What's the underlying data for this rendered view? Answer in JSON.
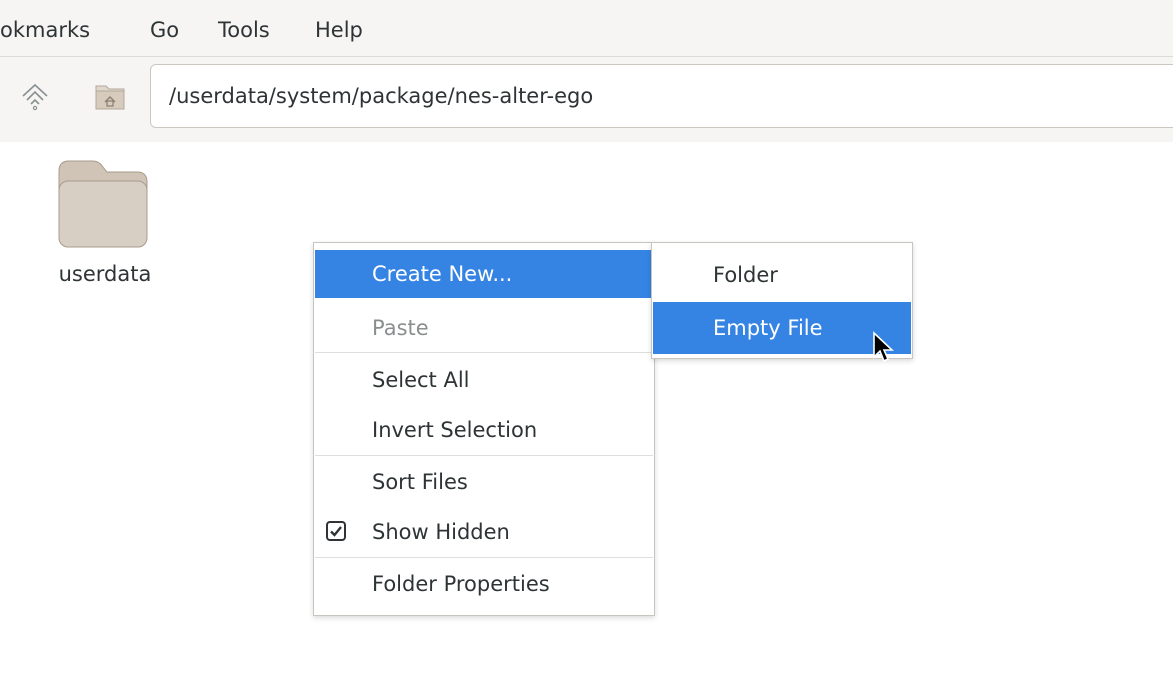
{
  "menubar": {
    "items": [
      "okmarks",
      "Go",
      "Tools",
      "Help"
    ]
  },
  "toolbar": {
    "up_icon": "go-up-icon",
    "home_icon": "home-folder-icon",
    "path": "/userdata/system/package/nes-alter-ego"
  },
  "files": [
    {
      "name": "userdata",
      "icon": "folder-icon"
    }
  ],
  "context_menu": {
    "items": {
      "create_new": "Create New...",
      "paste": "Paste",
      "select_all": "Select All",
      "invert_selection": "Invert Selection",
      "sort_files": "Sort Files",
      "show_hidden": "Show Hidden",
      "folder_properties": "Folder Properties"
    },
    "show_hidden_checked": true
  },
  "submenu": {
    "items": {
      "folder": "Folder",
      "empty_file": "Empty File"
    }
  },
  "colors": {
    "selection": "#3584e4",
    "folder": "#d8cfc4",
    "folder_tab": "#cfc4b6"
  }
}
